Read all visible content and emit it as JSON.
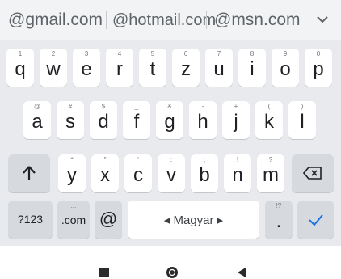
{
  "suggestions": [
    "@gmail.com",
    "@hotmail.com",
    "@msn.com"
  ],
  "suggestion_expand_icon": "chevron-down-icon",
  "row1": [
    {
      "label": "q",
      "hint": "1"
    },
    {
      "label": "w",
      "hint": "2"
    },
    {
      "label": "e",
      "hint": "3"
    },
    {
      "label": "r",
      "hint": "4"
    },
    {
      "label": "t",
      "hint": "5"
    },
    {
      "label": "z",
      "hint": "6"
    },
    {
      "label": "u",
      "hint": "7"
    },
    {
      "label": "i",
      "hint": "8"
    },
    {
      "label": "o",
      "hint": "9"
    },
    {
      "label": "p",
      "hint": "0"
    }
  ],
  "row2": [
    {
      "label": "a",
      "hint": "@"
    },
    {
      "label": "s",
      "hint": "#"
    },
    {
      "label": "d",
      "hint": "$"
    },
    {
      "label": "f",
      "hint": "_"
    },
    {
      "label": "g",
      "hint": "&"
    },
    {
      "label": "h",
      "hint": "-"
    },
    {
      "label": "j",
      "hint": "+"
    },
    {
      "label": "k",
      "hint": "("
    },
    {
      "label": "l",
      "hint": ")"
    }
  ],
  "row3": [
    {
      "label": "y",
      "hint": "*"
    },
    {
      "label": "x",
      "hint": "\""
    },
    {
      "label": "c",
      "hint": "'"
    },
    {
      "label": "v",
      "hint": ":"
    },
    {
      "label": "b",
      "hint": ";"
    },
    {
      "label": "n",
      "hint": "!"
    },
    {
      "label": "m",
      "hint": "?"
    }
  ],
  "keys": {
    "shift_icon": "shift-arrow-icon",
    "backspace_icon": "backspace-icon",
    "symbols_label": "?123",
    "com_label": ".com",
    "com_hint": "...",
    "at_label": "@",
    "space_label": "◂ Magyar ▸",
    "period_label": ".",
    "period_hint": "!?",
    "enter_icon": "checkmark-icon"
  },
  "navbar": {
    "recents_icon": "square-recents-icon",
    "home_icon": "circle-home-icon",
    "back_icon": "triangle-back-icon"
  },
  "colors": {
    "keyboard_bg": "#e8eaed",
    "key_bg": "#ffffff",
    "function_key_bg": "#d6d9dd",
    "accent": "#1a73e8",
    "text": "#202124"
  }
}
